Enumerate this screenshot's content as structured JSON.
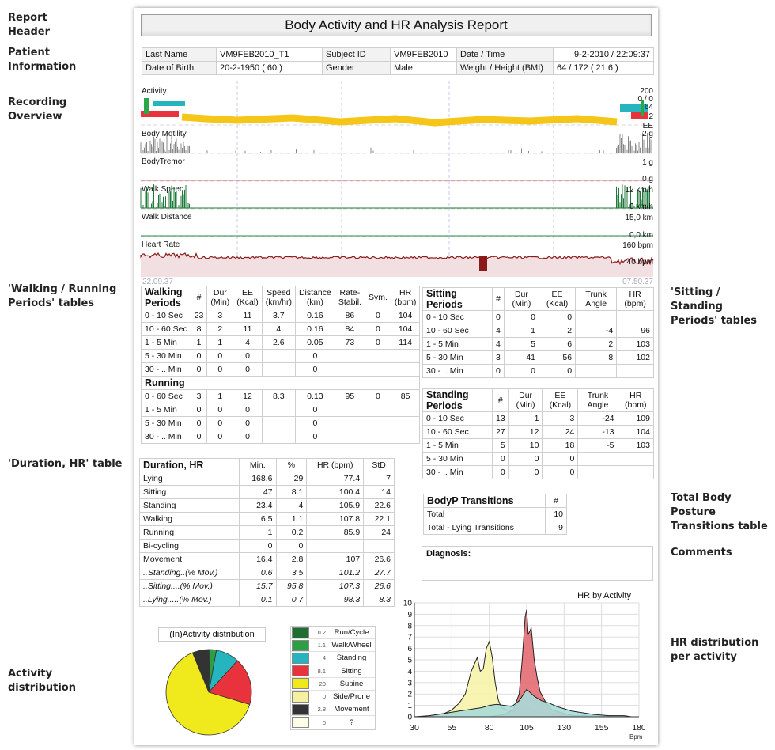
{
  "side_labels": {
    "report_header": "Report\nHeader",
    "patient_info": "Patient\nInformation",
    "recording": "Recording\nOverview",
    "walking": "'Walking / Running\nPeriods' tables",
    "sitting": "'Sitting / Standing\nPeriods' tables",
    "duration": "'Duration, HR' table",
    "transitions": "Total Body Posture\nTransitions table",
    "comments": "Comments",
    "activity_dist": "Activity\ndistribution",
    "hr_dist": "HR distribution\nper activity"
  },
  "title": "Body Activity and HR Analysis Report",
  "patient": {
    "last_name_label": "Last Name",
    "last_name": "VM9FEB2010_T1",
    "subject_id_label": "Subject ID",
    "subject_id": "VM9FEB2010",
    "datetime_label": "Date / Time",
    "datetime": "9-2-2010 / 22:09:37",
    "dob_label": "Date of Birth",
    "dob": "20-2-1950  ( 60 )",
    "gender_label": "Gender",
    "gender": "Male",
    "weight_label": "Weight / Height (BMI)",
    "weight": "64  /  172  (  21.6  )"
  },
  "overview": {
    "tracks": [
      "Activity",
      "Body Motility",
      "BodyTremor",
      "Walk Speed",
      "Walk Distance",
      "Heart Rate"
    ],
    "scale_labels": {
      "activity_top": "200",
      "activity_mid": "0 / 0",
      "activity_64": "64",
      "activity_2": "2",
      "activity_ee": "EE",
      "motility": "2 g",
      "tremor_top": "1 g",
      "tremor_bottom": "0 g",
      "speed_top": "12 km/h",
      "speed_bottom": "0 km/h",
      "distance_top": "15,0 km",
      "distance_bottom": "0,0 km",
      "hr_top": "160 bpm",
      "hr_bottom": "40 bpm"
    },
    "start_time": "22.09.37",
    "end_time": "07.50.37"
  },
  "walking": {
    "title": "Walking Periods",
    "headers": [
      "#",
      "Dur (Min)",
      "EE (Kcal)",
      "Speed (km/hr)",
      "Distance (km)",
      "Rate-Stabil.",
      "Sym.",
      "HR (bpm)"
    ],
    "rows": [
      [
        "0 - 10 Sec",
        "23",
        "3",
        "11",
        "3.7",
        "0.16",
        "86",
        "0",
        "104"
      ],
      [
        "10 - 60 Sec",
        "8",
        "2",
        "11",
        "4",
        "0.16",
        "84",
        "0",
        "104"
      ],
      [
        "1 - 5 Min",
        "1",
        "1",
        "4",
        "2.6",
        "0.05",
        "73",
        "0",
        "114"
      ],
      [
        "5 - 30 Min",
        "0",
        "0",
        "0",
        "",
        "0",
        "",
        "",
        ""
      ],
      [
        "30 - .. Min",
        "0",
        "0",
        "0",
        "",
        "0",
        "",
        "",
        ""
      ]
    ],
    "running_title": "Running",
    "running_rows": [
      [
        "0 - 60 Sec",
        "3",
        "1",
        "12",
        "8.3",
        "0.13",
        "95",
        "0",
        "85"
      ],
      [
        "1 - 5 Min",
        "0",
        "0",
        "0",
        "",
        "0",
        "",
        "",
        ""
      ],
      [
        "5 - 30 Min",
        "0",
        "0",
        "0",
        "",
        "0",
        "",
        "",
        ""
      ],
      [
        "30 - .. Min",
        "0",
        "0",
        "0",
        "",
        "0",
        "",
        "",
        ""
      ]
    ]
  },
  "sitting": {
    "title": "Sitting Periods",
    "headers": [
      "#",
      "Dur (Min)",
      "EE (Kcal)",
      "Trunk Angle",
      "HR (bpm)"
    ],
    "rows": [
      [
        "0 - 10 Sec",
        "0",
        "0",
        "0",
        "",
        ""
      ],
      [
        "10 - 60 Sec",
        "4",
        "1",
        "2",
        "-4",
        "96"
      ],
      [
        "1 - 5 Min",
        "4",
        "5",
        "6",
        "2",
        "103"
      ],
      [
        "5 - 30 Min",
        "3",
        "41",
        "56",
        "8",
        "102"
      ],
      [
        "30 - .. Min",
        "0",
        "0",
        "0",
        "",
        ""
      ]
    ]
  },
  "standing": {
    "title": "Standing Periods",
    "headers": [
      "#",
      "Dur (Min)",
      "EE (Kcal)",
      "Trunk Angle",
      "HR (bpm)"
    ],
    "rows": [
      [
        "0 - 10 Sec",
        "13",
        "1",
        "3",
        "-24",
        "109"
      ],
      [
        "10 - 60 Sec",
        "27",
        "12",
        "24",
        "-13",
        "104"
      ],
      [
        "1 - 5 Min",
        "5",
        "10",
        "18",
        "-5",
        "103"
      ],
      [
        "5 - 30 Min",
        "0",
        "0",
        "0",
        "",
        ""
      ],
      [
        "30 - .. Min",
        "0",
        "0",
        "0",
        "",
        ""
      ]
    ]
  },
  "duration": {
    "title": "Duration, HR",
    "headers": [
      "Min.",
      "%",
      "HR (bpm)",
      "StD"
    ],
    "rows": [
      [
        "Lying",
        "168.6",
        "29",
        "77.4",
        "7"
      ],
      [
        "Sitting",
        "47",
        "8.1",
        "100.4",
        "14"
      ],
      [
        "Standing",
        "23.4",
        "4",
        "105.9",
        "22.6"
      ],
      [
        "Walking",
        "6.5",
        "1.1",
        "107.8",
        "22.1"
      ],
      [
        "Running",
        "1",
        "0.2",
        "85.9",
        "24"
      ],
      [
        "Bi-cycling",
        "0",
        "0",
        "",
        ""
      ],
      [
        "Movement",
        "16.4",
        "2.8",
        "107",
        "26.6"
      ]
    ],
    "italic_rows": [
      [
        "..Standing..(% Mov.)",
        "0.6",
        "3.5",
        "101.2",
        "27.7"
      ],
      [
        "..Sitting....(% Mov.)",
        "15.7",
        "95.8",
        "107.3",
        "26.6"
      ],
      [
        "..Lying.....(% Mov.)",
        "0.1",
        "0.7",
        "98.3",
        "8.3"
      ]
    ]
  },
  "transitions": {
    "title": "BodyP Transitions",
    "hash": "#",
    "rows": [
      [
        "Total",
        "10"
      ],
      [
        "Total - Lying Transitions",
        "9"
      ]
    ]
  },
  "diagnosis_label": "Diagnosis:",
  "pie": {
    "title": "(In)Activity distribution",
    "items": [
      {
        "value": "0.2",
        "name": "Run/Cycle",
        "color": "#1e6e32"
      },
      {
        "value": "1.1",
        "name": "Walk/Wheel",
        "color": "#2e9e44"
      },
      {
        "value": "4",
        "name": "Standing",
        "color": "#26b5bf"
      },
      {
        "value": "8.1",
        "name": "Sitting",
        "color": "#e8323c"
      },
      {
        "value": "29",
        "name": "Supine",
        "color": "#f0ea1c"
      },
      {
        "value": "0",
        "name": "Side/Prone",
        "color": "#f4f0a0"
      },
      {
        "value": "2.8",
        "name": "Movement",
        "color": "#333333"
      },
      {
        "value": "0",
        "name": "?",
        "color": "#fdfde8"
      }
    ]
  },
  "chart_data": {
    "type": "area",
    "title": "HR by Activity",
    "xlabel": "Bpm",
    "ylabel": "",
    "xlim": [
      30,
      180
    ],
    "ylim": [
      0,
      10
    ],
    "xticks": [
      "30",
      "55",
      "80",
      "105",
      "130",
      "155",
      "180"
    ],
    "yticks": [
      "0",
      "1",
      "2",
      "3",
      "4",
      "5",
      "6",
      "7",
      "8",
      "9",
      "10"
    ],
    "series": [
      {
        "color": "#f6f4a8",
        "x": [
          30,
          36,
          44,
          50,
          55,
          60,
          64,
          68,
          72,
          74,
          76,
          78,
          80,
          82,
          84,
          86,
          88,
          92,
          96,
          100,
          104,
          108,
          112,
          116,
          120,
          128,
          136,
          150,
          165,
          172,
          180
        ],
        "values": [
          0,
          0,
          0.1,
          0.3,
          0.6,
          1.2,
          2,
          4,
          5.2,
          4,
          4.2,
          6,
          6.6,
          5.2,
          3,
          1.5,
          0.8,
          0.6,
          0.5,
          0.6,
          0.8,
          0.6,
          0.4,
          0.3,
          0.2,
          0.1,
          0.1,
          0.1,
          0,
          0,
          0
        ]
      },
      {
        "color": "#e46a72",
        "x": [
          30,
          60,
          80,
          90,
          96,
          100,
          102,
          104,
          105,
          106,
          108,
          110,
          112,
          114,
          118,
          122,
          130,
          140,
          180
        ],
        "values": [
          0,
          0,
          0,
          0.2,
          0.6,
          2,
          5,
          8.8,
          9.4,
          7.2,
          7.8,
          5,
          3.4,
          2.2,
          1.2,
          0.6,
          0.3,
          0,
          0
        ]
      },
      {
        "color": "#a9dcd8",
        "x": [
          30,
          40,
          50,
          55,
          60,
          65,
          70,
          75,
          80,
          85,
          90,
          95,
          100,
          105,
          110,
          115,
          120,
          125,
          130,
          135,
          140,
          150,
          160,
          170,
          175,
          180
        ],
        "values": [
          0,
          0.1,
          0.3,
          0.4,
          0.5,
          0.6,
          0.7,
          0.8,
          1,
          1.1,
          1,
          0.9,
          1.4,
          2.4,
          1.8,
          1.4,
          1.2,
          0.9,
          0.7,
          0.5,
          0.4,
          0.2,
          0.1,
          0.1,
          0,
          0
        ]
      }
    ]
  }
}
